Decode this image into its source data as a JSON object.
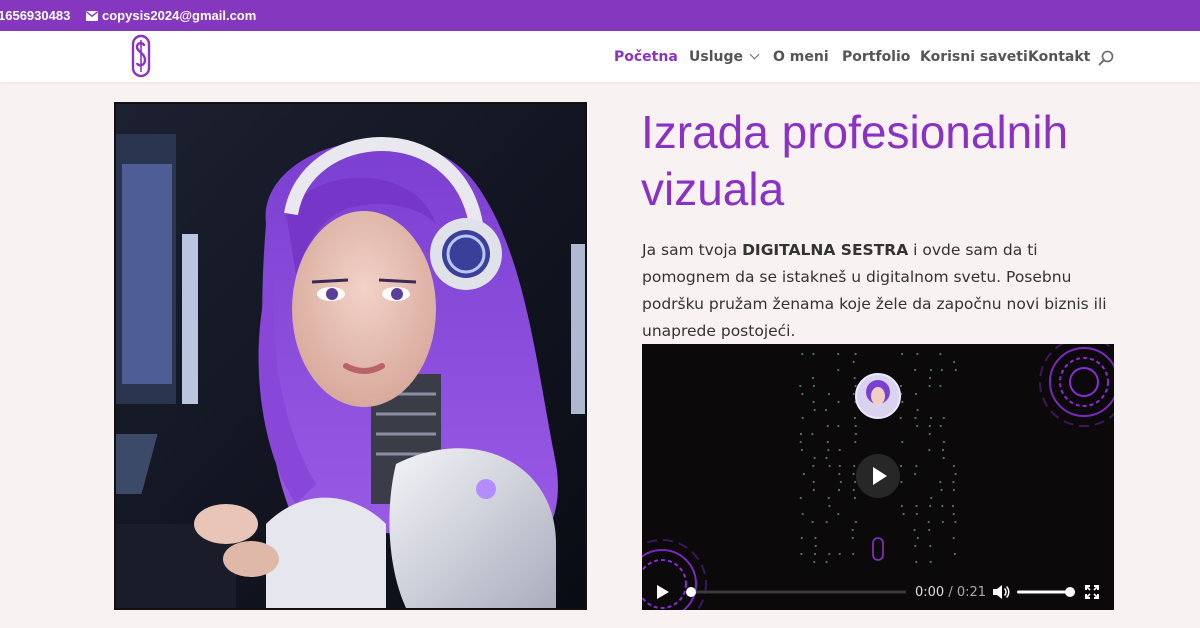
{
  "topbar": {
    "phone": "1656930483",
    "email": "copysis2024@gmail.com"
  },
  "nav": {
    "items": [
      {
        "label": "Početna",
        "active": true
      },
      {
        "label": "Usluge",
        "dropdown": true
      },
      {
        "label": "O meni"
      },
      {
        "label": "Portfolio"
      },
      {
        "label": "Korisni saveti"
      },
      {
        "label": "Kontakt"
      }
    ]
  },
  "hero": {
    "title": "Izrada profesionalnih vizuala",
    "intro_before": "Ja sam tvoja ",
    "intro_bold": "DIGITALNA SESTRA",
    "intro_after": " i ovde sam da ti pomognem da se istakneš u digitalnom svetu. Posebnu podršku pružam ženama koje žele da započnu novi biznis ili unaprede postojeći."
  },
  "video": {
    "current_time": "0:00",
    "separator": " / ",
    "duration": "0:21",
    "progress": 0,
    "volume": 1
  },
  "colors": {
    "brand": "#8537c0",
    "accent": "#8b32c5",
    "page_bg": "#f8f3f2"
  }
}
